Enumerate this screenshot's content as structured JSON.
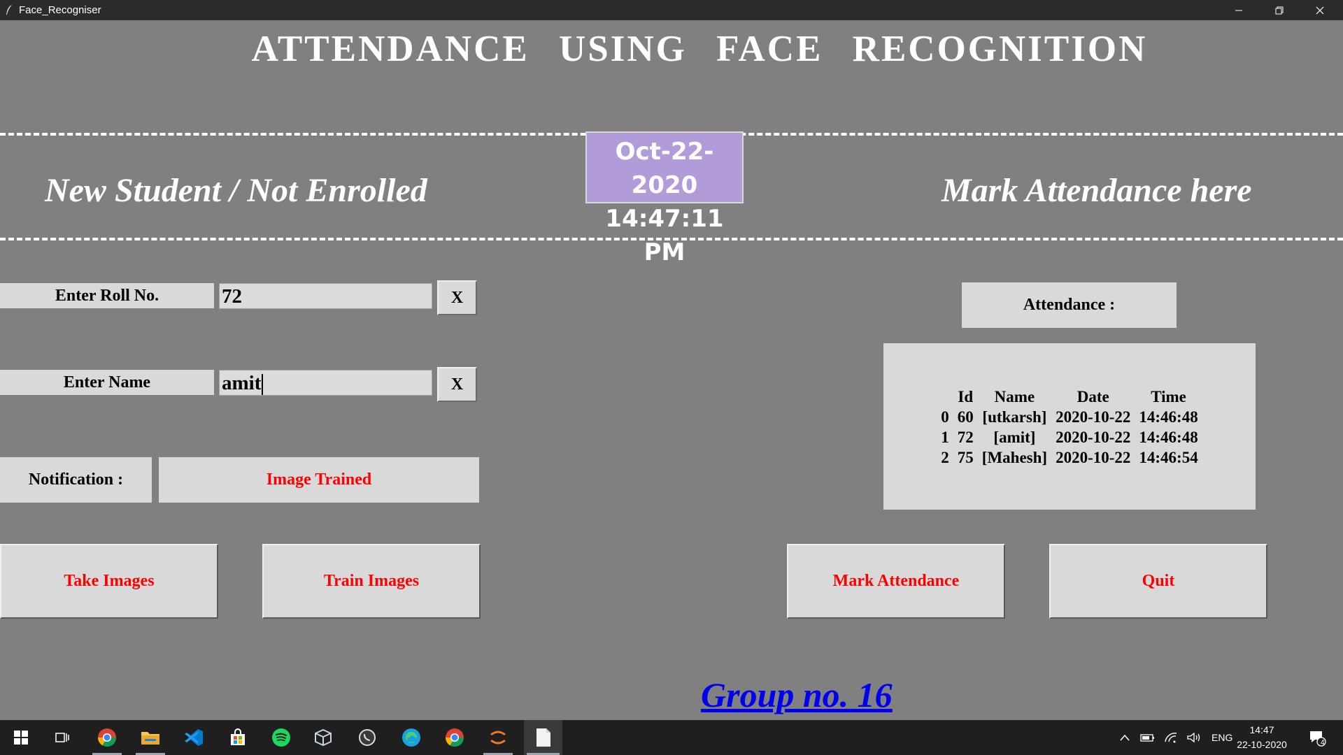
{
  "window": {
    "title": "Face_Recogniser"
  },
  "header": {
    "title": "ATTENDANCE USING FACE RECOGNITION"
  },
  "left_section": {
    "heading": "New Student / Not Enrolled"
  },
  "right_section": {
    "heading": "Mark Attendance here"
  },
  "clock": {
    "date": "Oct-22-2020",
    "time": "14:47:11 PM"
  },
  "form": {
    "roll_label": "Enter Roll No.",
    "roll_value": "72",
    "name_label": "Enter Name",
    "name_value": "amit",
    "clear_label": "X",
    "notification_label": "Notification :",
    "notification_value": "Image Trained"
  },
  "buttons": {
    "take_images": "Take Images",
    "train_images": "Train Images",
    "mark_attendance": "Mark Attendance",
    "quit": "Quit"
  },
  "attendance": {
    "label": "Attendance :",
    "columns": [
      "Id",
      "Name",
      "Date",
      "Time"
    ],
    "rows": [
      {
        "index": "0",
        "id": "60",
        "name": "[utkarsh]",
        "date": "2020-10-22",
        "time": "14:46:48"
      },
      {
        "index": "1",
        "id": "72",
        "name": "[amit]",
        "date": "2020-10-22",
        "time": "14:46:48"
      },
      {
        "index": "2",
        "id": "75",
        "name": "[Mahesh]",
        "date": "2020-10-22",
        "time": "14:46:54"
      }
    ]
  },
  "footer": {
    "group": "Group no. 16"
  },
  "taskbar": {
    "language": "ENG",
    "time": "14:47",
    "date": "22-10-2020",
    "notification_count": "4",
    "apps": [
      "start-icon",
      "task-view-icon",
      "chrome-icon",
      "file-explorer-icon",
      "vscode-icon",
      "store-icon",
      "spotify-icon",
      "virtualbox-icon",
      "whatsapp-icon",
      "edge-icon",
      "chrome-icon",
      "jupyter-icon",
      "notepad-icon"
    ]
  },
  "colors": {
    "background": "#808080",
    "accent_red": "#ff0000",
    "clock_bg": "#b19cd9",
    "link_blue": "#0000ee"
  }
}
